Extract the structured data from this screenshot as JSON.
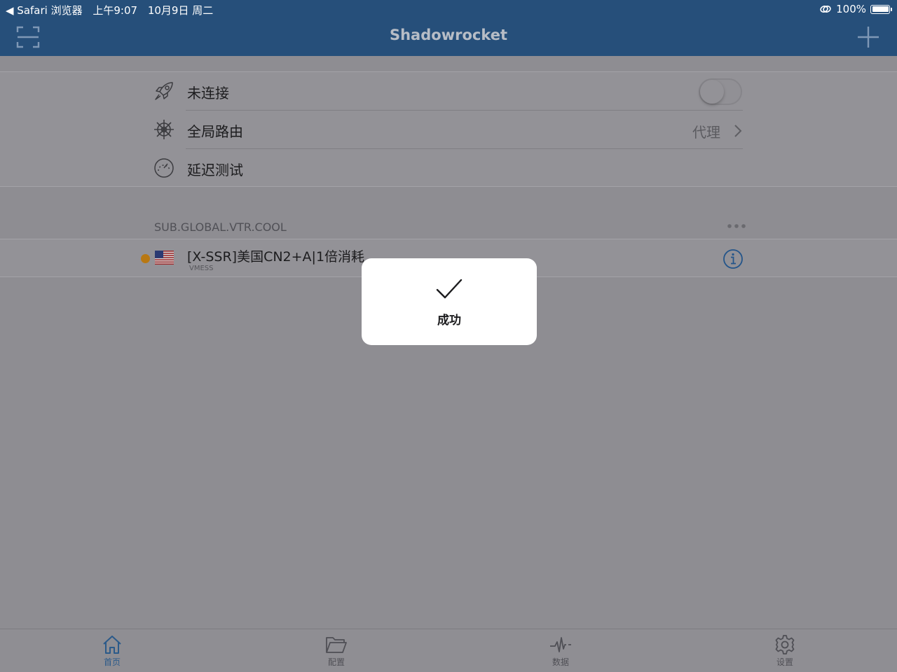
{
  "status_bar": {
    "back_app": "◀ Safari 浏览器",
    "time": "上午9:07",
    "date": "10月9日 周二",
    "battery": "100%"
  },
  "nav": {
    "title": "Shadowrocket"
  },
  "main_group": {
    "connection_label": "未连接",
    "connection_on": false,
    "routing_label": "全局路由",
    "routing_value": "代理",
    "latency_label": "延迟测试"
  },
  "subscription": {
    "name": "SUB.GLOBAL.VTR.COOL",
    "servers": [
      {
        "name": "[X-SSR]美国CN2+A|1倍消耗",
        "type": "VMESS"
      }
    ]
  },
  "hud": {
    "message": "成功"
  },
  "tabbar": {
    "items": [
      {
        "label": "首页",
        "icon": "home-icon",
        "active": true
      },
      {
        "label": "配置",
        "icon": "folder-icon",
        "active": false
      },
      {
        "label": "数据",
        "icon": "activity-icon",
        "active": false
      },
      {
        "label": "设置",
        "icon": "gear-icon",
        "active": false
      }
    ]
  },
  "colors": {
    "nav_bar": "#264f7a",
    "accent": "#2b5a8a",
    "status_dot": "#b87813"
  }
}
